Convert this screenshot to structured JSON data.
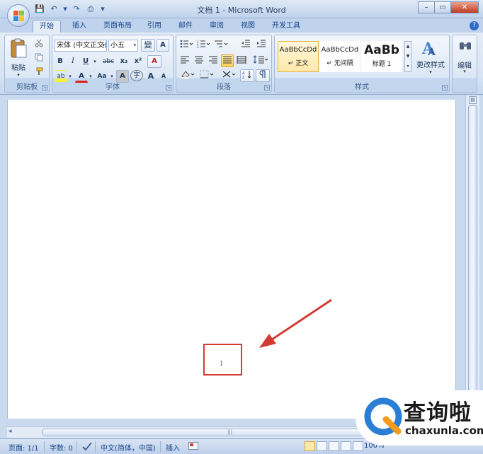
{
  "window": {
    "title": "文档 1 - Microsoft Word",
    "controls": {
      "minimize": "–",
      "restore": "▭",
      "close": "✕"
    }
  },
  "quick_access": {
    "save_icon": "💾",
    "undo_icon": "↶",
    "undo_drop": "▾",
    "redo_icon": "↷",
    "print_icon": "⎙",
    "customize_icon": "▾"
  },
  "tabs": [
    {
      "label": "开始",
      "active": true
    },
    {
      "label": "插入"
    },
    {
      "label": "页面布局"
    },
    {
      "label": "引用"
    },
    {
      "label": "邮件"
    },
    {
      "label": "审阅"
    },
    {
      "label": "视图"
    },
    {
      "label": "开发工具"
    }
  ],
  "help_label": "?",
  "ribbon": {
    "clipboard": {
      "group_label": "剪贴板",
      "paste_label": "粘贴",
      "paste_drop": "▾"
    },
    "font": {
      "group_label": "字体",
      "font_name": "宋体 (中文正文)",
      "font_size": "小五",
      "wen_label": "變",
      "a_box_label": "A",
      "bold": "B",
      "italic": "I",
      "underline": "U",
      "strike": "abc",
      "subscript": "x₂",
      "superscript": "x²",
      "clear_format": "A",
      "highlight": "ab",
      "font_color": "A",
      "change_case": "Aa",
      "char_shading": "A",
      "enclose": "字",
      "grow": "A",
      "shrink": "A"
    },
    "paragraph": {
      "group_label": "段落"
    },
    "styles": {
      "group_label": "样式",
      "tiles": [
        {
          "sample": "AaBbCcDd",
          "name": "↵ 正文",
          "selected": true
        },
        {
          "sample": "AaBbCcDd",
          "name": "↵ 无间隔",
          "selected": false
        },
        {
          "sample": "AaBb",
          "name": "标题 1",
          "selected": false
        }
      ],
      "change_styles": "更改样式"
    },
    "editing": {
      "group_label": "编辑"
    }
  },
  "document": {
    "page_number": "1"
  },
  "statusbar": {
    "page": "页面: 1/1",
    "words": "字数: 0",
    "language": "中文(简体，中国)",
    "mode": "插入",
    "zoom": "100%"
  },
  "watermark": {
    "cn": "查询啦",
    "en": "chaxunla.com"
  },
  "colors": {
    "accent": "#15428b",
    "highlight_box": "#d33a31",
    "arrow": "#d33a31",
    "watermark_blue": "#2a7fd4",
    "watermark_orange": "#f29b1d"
  }
}
